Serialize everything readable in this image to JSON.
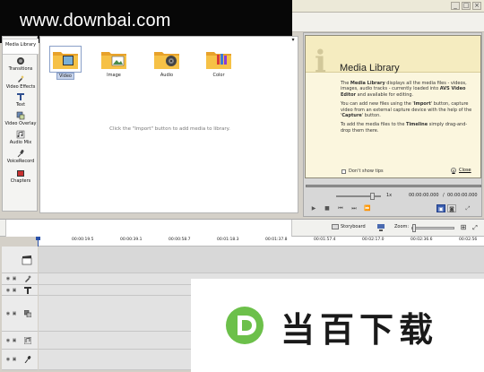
{
  "watermark": {
    "text": "www.downbai.com"
  },
  "window": {
    "min": "_",
    "max": "□",
    "close": "×"
  },
  "sidebar": {
    "items": [
      {
        "label": "Media Library",
        "icon": "media-library-icon"
      },
      {
        "label": "Transitions",
        "icon": "transitions-icon"
      },
      {
        "label": "Video Effects",
        "icon": "video-effects-icon"
      },
      {
        "label": "Text",
        "icon": "text-icon"
      },
      {
        "label": "Video Overlay",
        "icon": "video-overlay-icon"
      },
      {
        "label": "Audio Mix",
        "icon": "audio-mix-icon"
      },
      {
        "label": "VoiceRecord",
        "icon": "voice-record-icon"
      },
      {
        "label": "Chapters",
        "icon": "chapters-icon"
      }
    ]
  },
  "media": {
    "dropdown": "▾",
    "tiles": [
      {
        "label": "Video",
        "icon": "video-folder-icon"
      },
      {
        "label": "Image",
        "icon": "image-folder-icon"
      },
      {
        "label": "Audio",
        "icon": "audio-folder-icon"
      },
      {
        "label": "Color",
        "icon": "color-folder-icon"
      }
    ],
    "hint": "Click the \"Import\" button to add media to library."
  },
  "tip": {
    "title": "Media Library",
    "p1_a": "The ",
    "p1_b": "Media Library",
    "p1_c": " displays all the media files - videos, images, audio tracks - currently loaded into ",
    "p1_d": "AVS Video Editor",
    "p1_e": " and available for editing.",
    "p2_a": "You can add new files using the '",
    "p2_b": "Import",
    "p2_c": "' button, capture video from an external capture device with the help of the '",
    "p2_d": "Capture",
    "p2_e": "' button.",
    "p3_a": "To add the media files to the ",
    "p3_b": "Timeline",
    "p3_c": " simply drag-and-drop them there.",
    "dont_show": "Don't show tips",
    "close": "Close"
  },
  "player": {
    "speed": "1x",
    "time_current": "00:00:00.000",
    "time_sep": "/",
    "time_total": "00:00:00.000"
  },
  "timeline": {
    "storyboard": "Storyboard",
    "zoom_label": "Zoom:",
    "ruler": [
      "00:00:19.5",
      "00:00:39.1",
      "00:00:58.7",
      "00:01:18.3",
      "00:01:37.8",
      "00:01:57.4",
      "00:02:17.0",
      "00:02:36.6",
      "00:02:56"
    ]
  },
  "logo": {
    "text": "当百下载",
    "mark": "D"
  },
  "colors": {
    "accent": "#3a5eb0",
    "logo_green": "#6cc04a"
  }
}
